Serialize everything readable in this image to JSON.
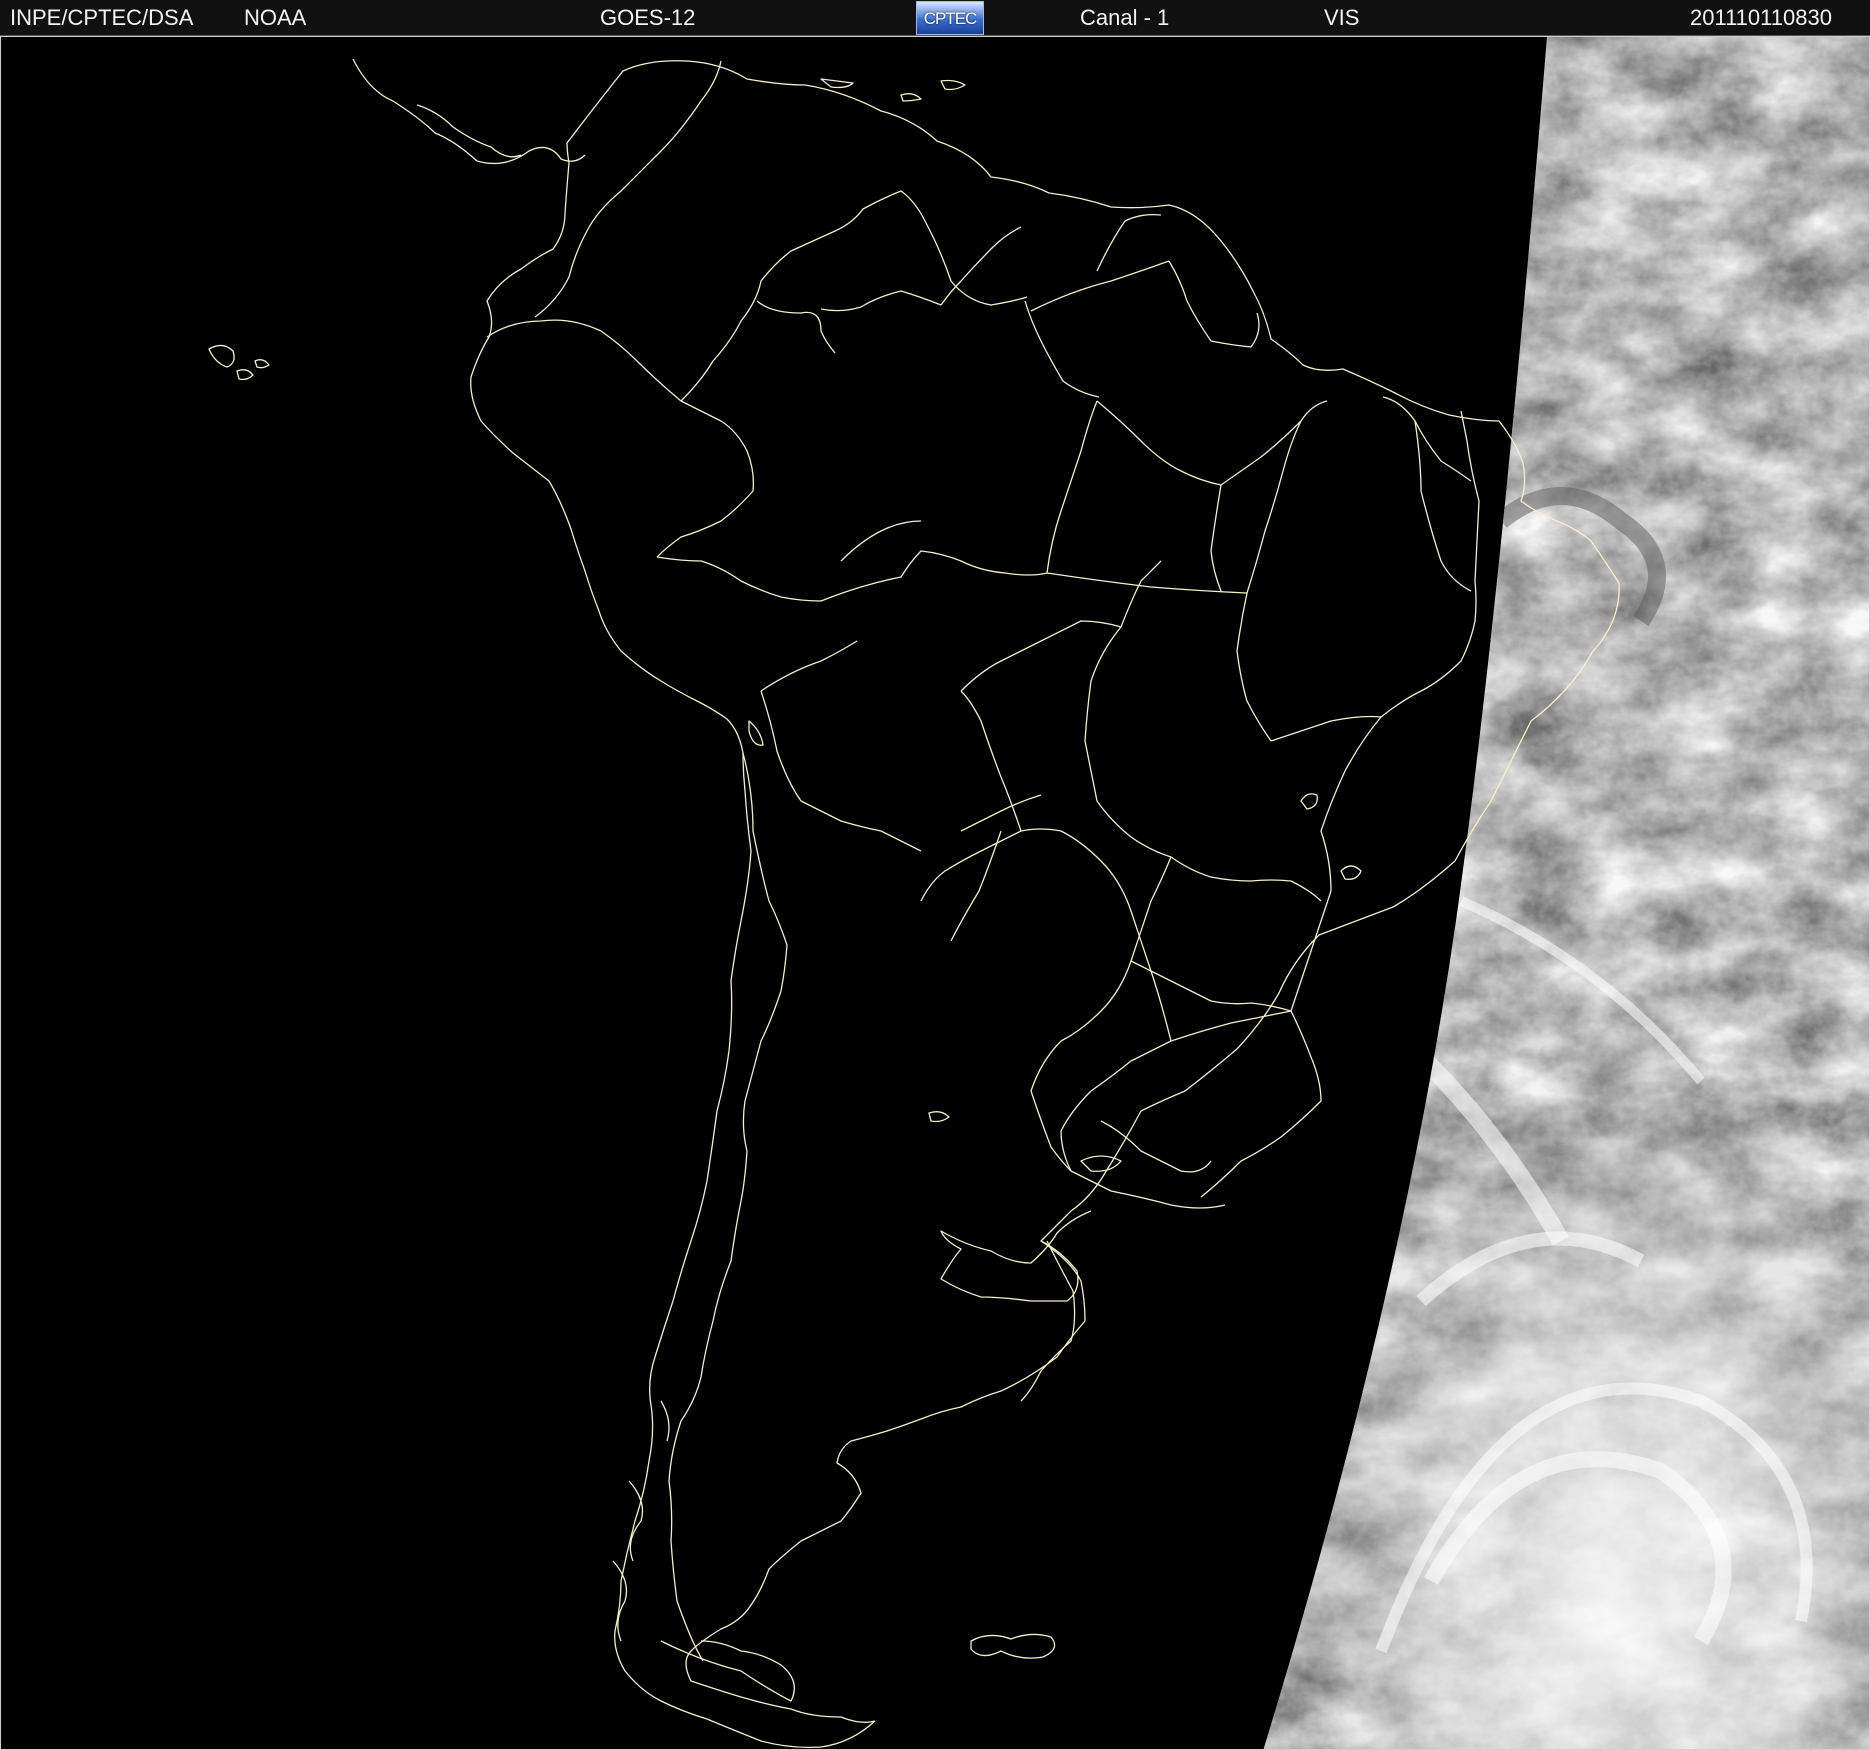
{
  "header": {
    "institution": "INPE/CPTEC/DSA",
    "agency": "NOAA",
    "satellite": "GOES-12",
    "logo_text": "CPTEC",
    "channel": "Canal - 1",
    "band": "VIS",
    "timestamp": "201110110830"
  },
  "colors": {
    "background": "#000000",
    "boundaries": "#f3f0c8",
    "header_bg": "#111111",
    "header_text": "#f2f2f2"
  },
  "map": {
    "region": "South America",
    "image_type": "visible satellite image, terminator with night side on the west",
    "boundaries": [
      "coastlines",
      "country borders",
      "Brazilian state borders"
    ]
  }
}
